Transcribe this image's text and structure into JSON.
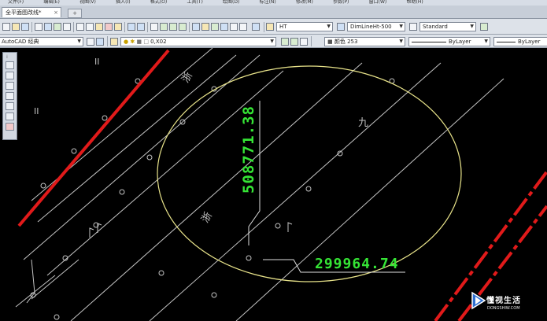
{
  "menubar": {
    "items": [
      "文件(F)",
      "编辑(E)",
      "视图(V)",
      "插入(I)",
      "格式(O)",
      "工具(T)",
      "绘图(D)",
      "标注(N)",
      "修改(M)",
      "参数(P)",
      "窗口(W)",
      "帮助(H)"
    ]
  },
  "tabs": {
    "document_tab": "全平面图改线*",
    "close_glyph": "×"
  },
  "toolbar": {
    "text_style": "HT",
    "dim_style": "DimLineHt-500",
    "table_style": "Standard"
  },
  "properties": {
    "workspace": "AutoCAD 经典",
    "layer": "0,X02",
    "color": "颜色 253",
    "linetype": "ByLayer",
    "lineweight": "ByLayer"
  },
  "drawing": {
    "coord_y": "508771.38",
    "coord_x": "299964.74",
    "label_zhe1": "浙",
    "label_zhe2": "浙",
    "label_jiu": "九",
    "label_ii1": "II",
    "label_ii2": "II",
    "colors": {
      "red_line": "#e11a1a",
      "coord_text": "#35e435",
      "circle": "#e8e38a",
      "lines": "#bfbfbf"
    }
  },
  "watermark": {
    "text": "懂视生活",
    "url": "DONGSHIW.COM"
  }
}
